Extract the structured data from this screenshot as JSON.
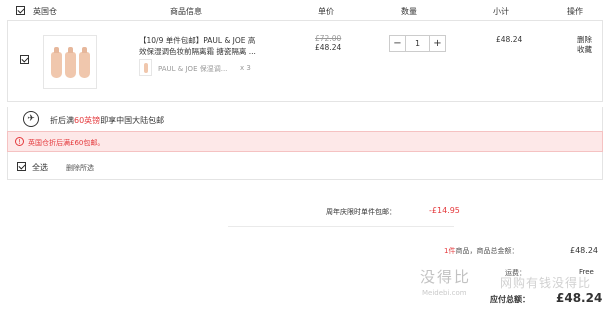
{
  "header": {
    "store": "英国仓",
    "col_product": "商品信息",
    "col_price": "单价",
    "col_qty": "数量",
    "col_subtotal": "小计",
    "col_action": "操作"
  },
  "item": {
    "title_line1": "【10/9 单件包邮】PAUL & JOE 高",
    "title_line2": "效保湿调色妆前隔离霜 搪瓷隔离 ...",
    "sub_name": "PAUL & JOE 保湿调...",
    "sub_qty": "x 3",
    "old_price": "£72.00",
    "price": "£48.24",
    "qty_minus": "−",
    "qty_value": "1",
    "qty_plus": "+",
    "subtotal": "£48.24",
    "delete_label": "删除",
    "favorite_label": "收藏"
  },
  "promo": {
    "icon": "airplane-icon",
    "text_before": "折后满",
    "highlight": "60英镑",
    "text_after": "即享中国大陆包邮"
  },
  "warning": {
    "icon": "info-icon",
    "text": "英国仓折后满£60包邮。",
    "color": "#e4393c"
  },
  "footer_select": {
    "select_all": "全选",
    "delete_selected": "删除所选"
  },
  "discount": {
    "label": "周年庆限时单件包邮：",
    "value": "-£14.95"
  },
  "summary": {
    "count_highlight": "1件",
    "count_text": "商品，商品总金额：",
    "total": "£48.24",
    "shipping_label": "运费：",
    "shipping_value": "Free",
    "payable_label": "应付总额：",
    "payable_value": "£48.24"
  },
  "watermark": {
    "brand": "没得比",
    "slogan": "网购有钱没得比",
    "url": "Meidebi.com"
  },
  "colors": {
    "accent_red": "#e4393c",
    "warning_bg": "#fde8e8"
  }
}
